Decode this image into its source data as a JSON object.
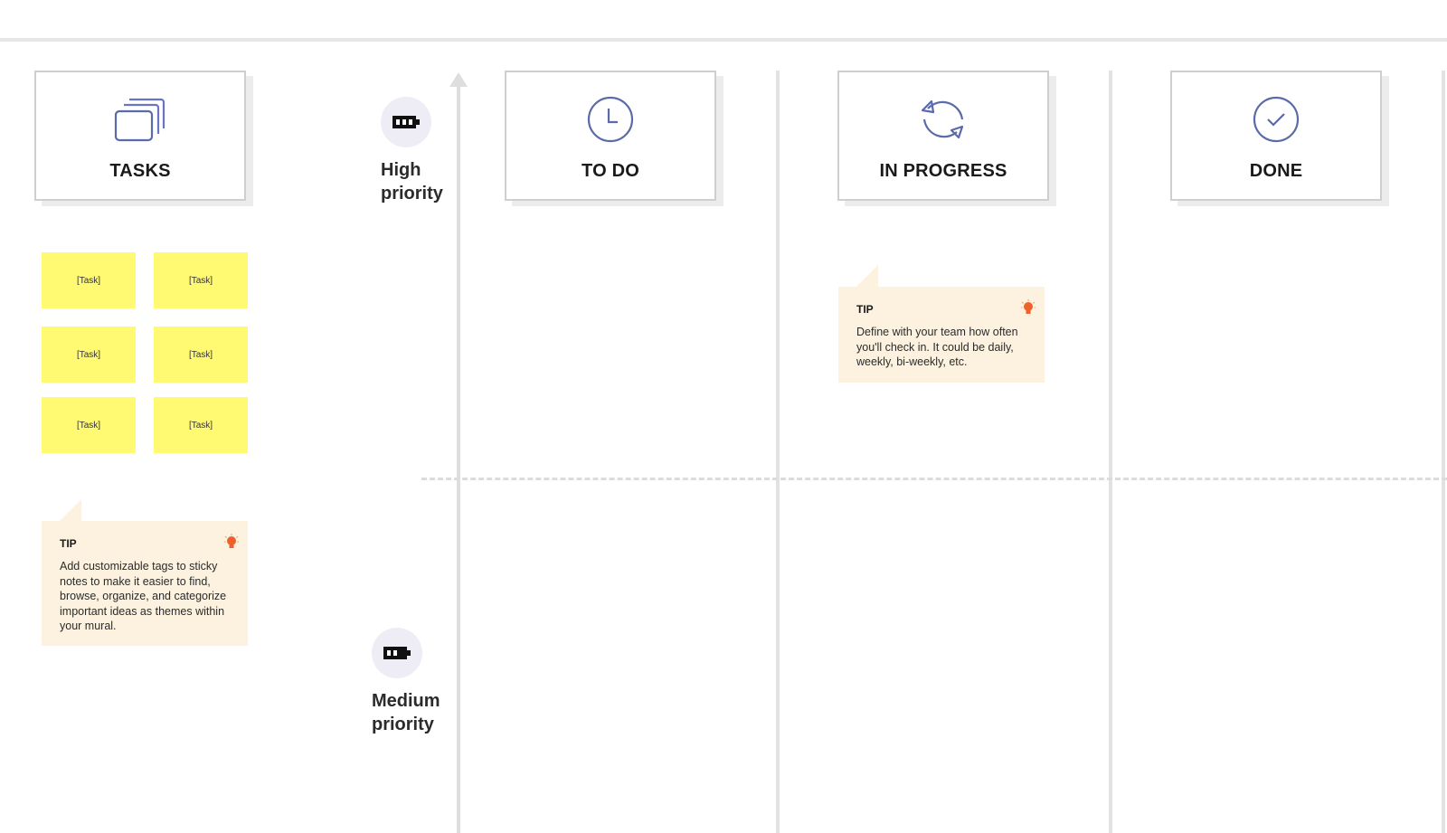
{
  "columns": [
    {
      "title": "TASKS",
      "icon": "stacked-cards-icon"
    },
    {
      "title": "TO DO",
      "icon": "clock-icon"
    },
    {
      "title": "IN PROGRESS",
      "icon": "refresh-cycle-icon"
    },
    {
      "title": "DONE",
      "icon": "check-circle-icon"
    }
  ],
  "priorities": [
    {
      "line1": "High",
      "line2": "priority",
      "icon": "battery-full-icon"
    },
    {
      "line1": "Medium",
      "line2": "priority",
      "icon": "battery-half-icon"
    }
  ],
  "tasks": [
    "[Task]",
    "[Task]",
    "[Task]",
    "[Task]",
    "[Task]",
    "[Task]"
  ],
  "tips": [
    {
      "title": "TIP",
      "body": "Add customizable tags to sticky notes to make it easier to find, browse, organize, and categorize important ideas as themes within your mural.",
      "icon": "lightbulb-icon"
    },
    {
      "title": "TIP",
      "body": "Define with your team how often you'll check in. It could be daily, weekly, bi-weekly, etc.",
      "icon": "lightbulb-icon"
    }
  ],
  "colors": {
    "icon_stroke": "#5a6aaa",
    "sticky": "#fffa72",
    "tip_bg": "#fcf2df",
    "bulb": "#f0602a",
    "badge_bg": "#eeedf6"
  }
}
